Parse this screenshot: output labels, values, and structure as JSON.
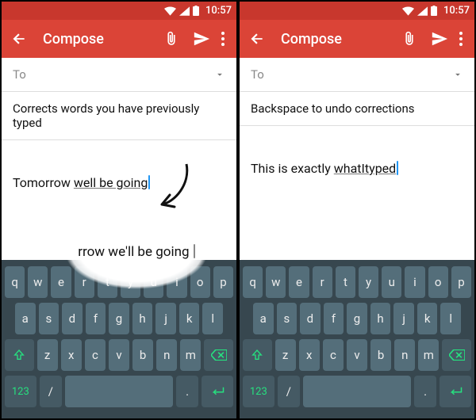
{
  "statusbar": {
    "time": "10:57"
  },
  "appbar": {
    "title": "Compose",
    "back": "back",
    "attach": "attach",
    "send": "send",
    "more": "more"
  },
  "kbd": {
    "row1": [
      "q",
      "w",
      "e",
      "r",
      "t",
      "y",
      "u",
      "i",
      "o",
      "p"
    ],
    "row2": [
      "a",
      "s",
      "d",
      "f",
      "g",
      "h",
      "j",
      "k",
      "l"
    ],
    "row3_mid": [
      "z",
      "x",
      "c",
      "v",
      "b",
      "n",
      "m"
    ],
    "numkey": "123",
    "slash": "/",
    "dot": "."
  },
  "left": {
    "to": "To",
    "subject": "Corrects words you have previously typed",
    "body_pre": "Tomorrow ",
    "body_under": "well be going",
    "callout": "rrow we'll be going "
  },
  "right": {
    "to": "To",
    "subject": "Backspace to undo corrections",
    "body_pre": "This is exactly ",
    "body_under": "whatItyped"
  }
}
